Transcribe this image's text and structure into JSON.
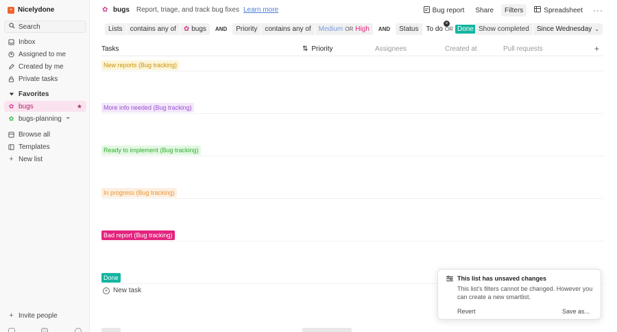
{
  "workspace": {
    "name": "Nicelydone"
  },
  "sidebar": {
    "search_label": "Search",
    "items": [
      {
        "label": "Inbox",
        "icon": "inbox-icon"
      },
      {
        "label": "Assigned to me",
        "icon": "user-icon"
      },
      {
        "label": "Created by me",
        "icon": "pencil-icon"
      },
      {
        "label": "Private tasks",
        "icon": "lock-icon"
      }
    ],
    "favorites_label": "Favorites",
    "favorites": [
      {
        "label": "bugs",
        "active": true
      },
      {
        "label": "bugs-planning",
        "active": false
      }
    ],
    "secondary": [
      {
        "label": "Browse all",
        "icon": "grid-icon"
      },
      {
        "label": "Templates",
        "icon": "template-icon"
      },
      {
        "label": "New list",
        "icon": "plus-icon"
      }
    ],
    "invite_label": "Invite people"
  },
  "header": {
    "title": "bugs",
    "description": "Report, triage, and track bug fixes",
    "learn_more": "Learn more",
    "bug_report": "Bug report",
    "share": "Share",
    "filters": "Filters",
    "spreadsheet": "Spreadsheet",
    "more": "···"
  },
  "filters": {
    "lists_field": "Lists",
    "lists_op": "contains any of",
    "lists_value": "bugs",
    "and1": "AND",
    "priority_field": "Priority",
    "priority_op": "contains any of",
    "priority_v1": "Medium",
    "or1": "OR",
    "priority_v2": "High",
    "and2": "AND",
    "status_field": "Status",
    "status_v1": "To do",
    "or2": "OR",
    "status_v2": "Done",
    "show_completed": "Show completed",
    "since": "Since Wednesday"
  },
  "table": {
    "columns": [
      "Tasks",
      "Priority",
      "Assignees",
      "Created at",
      "Pull requests"
    ],
    "add": "+",
    "groups": [
      {
        "label": "New reports (Bug tracking)",
        "color": "#e6b422",
        "bg": "#fdf5d8",
        "text_color": "#b88a10"
      },
      {
        "label": "More info needed (Bug tracking)",
        "color": "#a65bd6",
        "bg": "#f3e7fb",
        "text_color": "#8e44c4"
      },
      {
        "label": "Ready to implement (Bug tracking)",
        "color": "#3cbf3c",
        "bg": "#e3f8e3",
        "text_color": "#2fa62f"
      },
      {
        "label": "In progress (Bug tracking)",
        "color": "#f29a3b",
        "bg": "#fdefe0",
        "text_color": "#e08a2a"
      },
      {
        "label": "Bad report (Bug tracking)",
        "color": "#e4237e",
        "bg": "#e4237e",
        "text_color": "#ffffff"
      },
      {
        "label": "Done",
        "color": "#14b5a0",
        "bg": "#14b5a0",
        "text_color": "#ffffff"
      }
    ],
    "new_task": "New task"
  },
  "toast": {
    "title": "This list has unsaved changes",
    "body": "This list's filters cannot be changed. However you can create a new smartlist.",
    "revert": "Revert",
    "save_as": "Save as..."
  }
}
